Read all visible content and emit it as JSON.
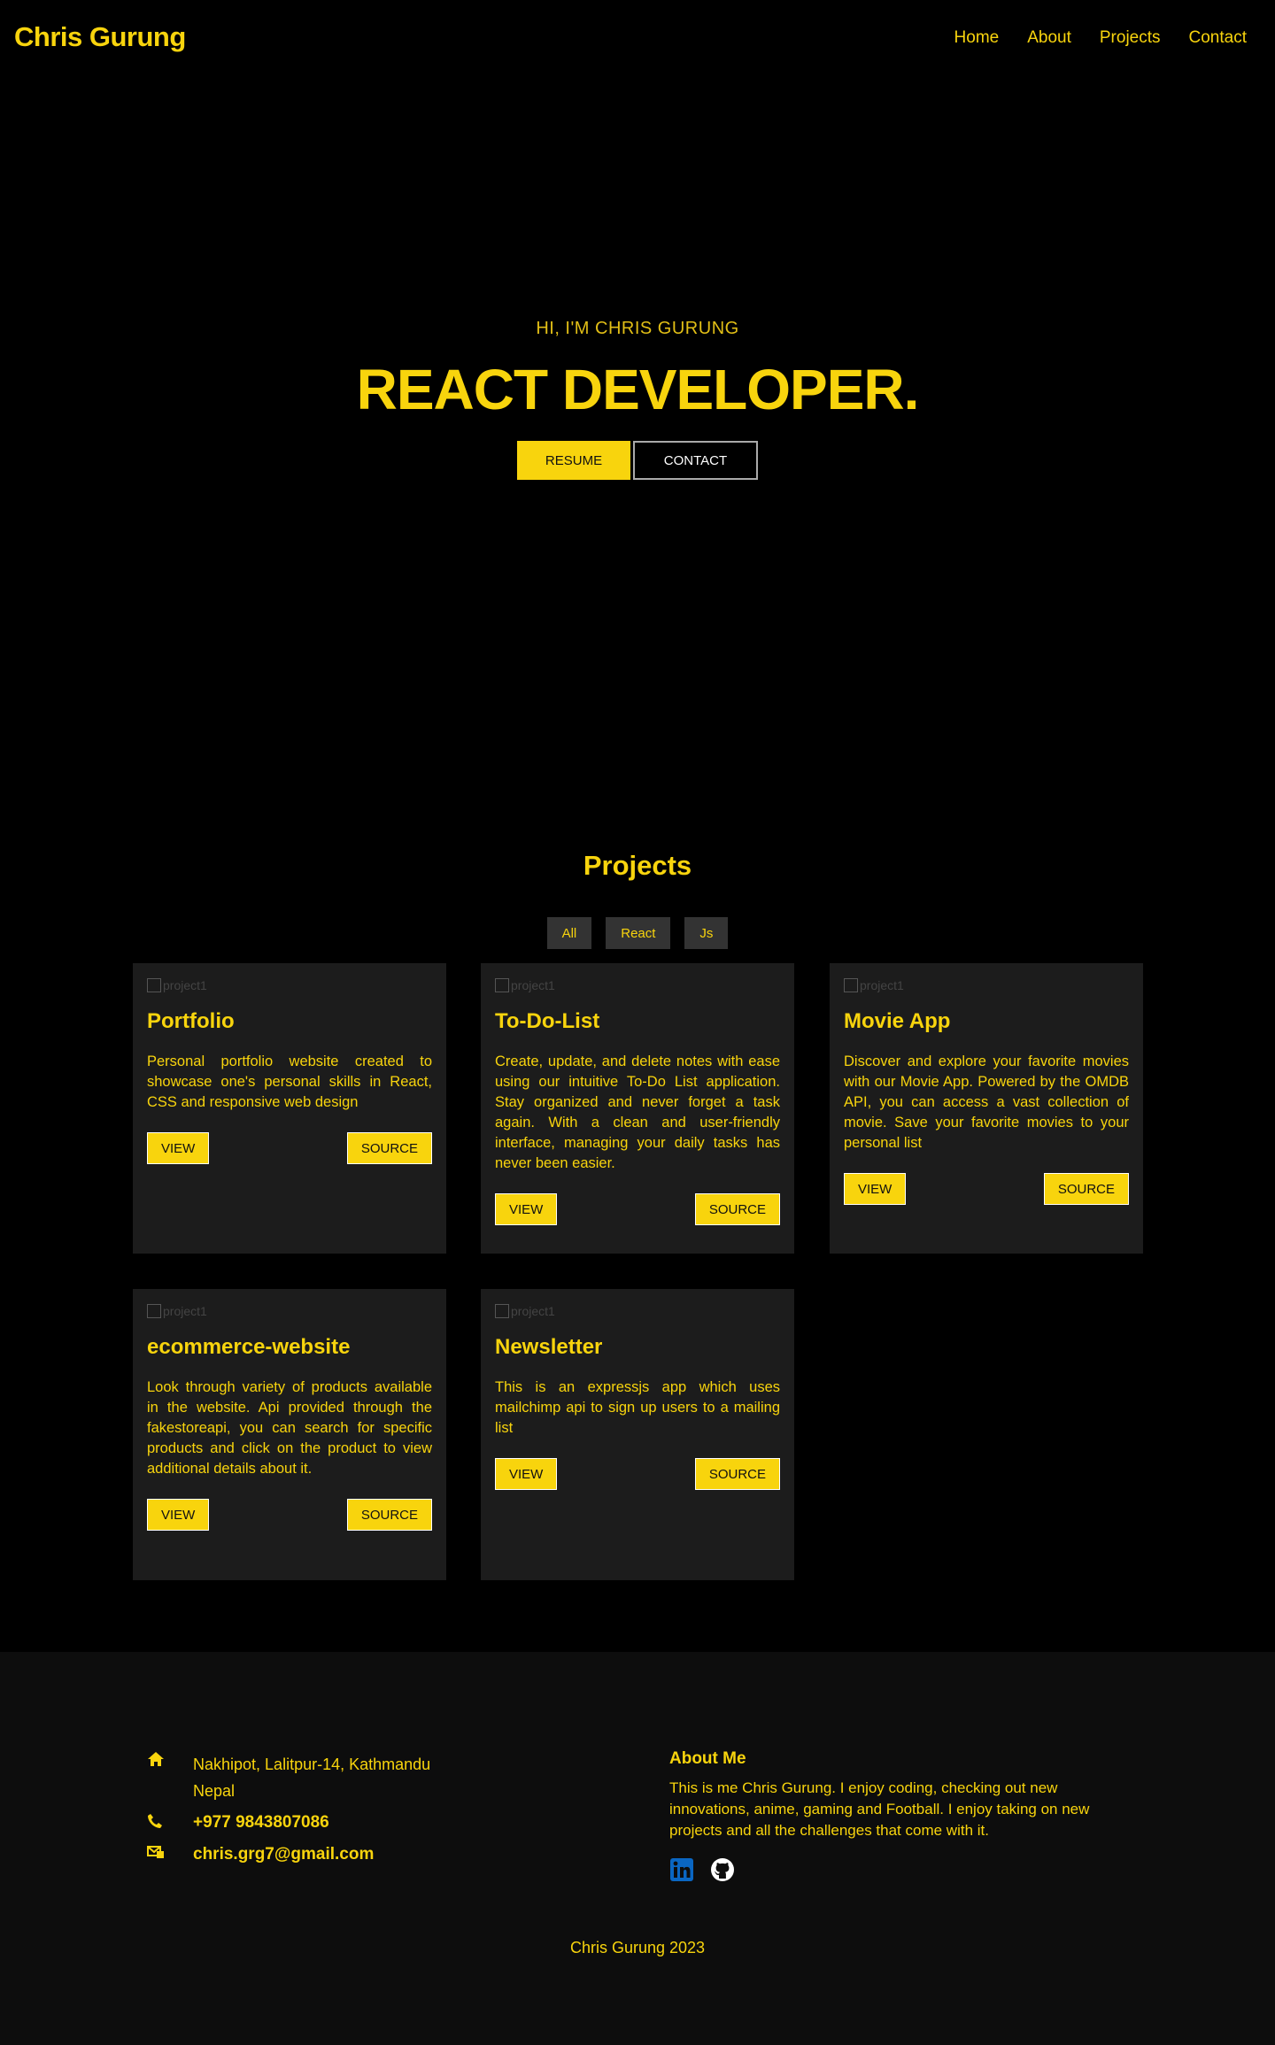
{
  "nav": {
    "brand": "Chris Gurung",
    "links": [
      "Home",
      "About",
      "Projects",
      "Contact"
    ]
  },
  "hero": {
    "kicker": "HI, I'M CHRIS GURUNG",
    "title": "REACT DEVELOPER.",
    "resume_label": "RESUME",
    "contact_label": "CONTACT"
  },
  "projects": {
    "title": "Projects",
    "filters": [
      "All",
      "React",
      "Js"
    ],
    "cards": [
      {
        "img_alt": "project1",
        "title": "Portfolio",
        "desc": "Personal portfolio website created to showcase one's personal skills in React, CSS and responsive web design",
        "view": "VIEW",
        "source": "SOURCE"
      },
      {
        "img_alt": "project1",
        "title": "To-Do-List",
        "desc": "Create, update, and delete notes with ease using our intuitive To-Do List application. Stay organized and never forget a task again. With a clean and user-friendly interface, managing your daily tasks has never been easier.",
        "view": "VIEW",
        "source": "SOURCE"
      },
      {
        "img_alt": "project1",
        "title": "Movie App",
        "desc": "Discover and explore your favorite movies with our Movie App. Powered by the OMDB API, you can access a vast collection of movie. Save your favorite movies to your personal list",
        "view": "VIEW",
        "source": "SOURCE"
      },
      {
        "img_alt": "project1",
        "title": "ecommerce-website",
        "desc": "Look through variety of products available in the website. Api provided through the fakestoreapi, you can search for specific products and click on the product to view additional details about it.",
        "view": "VIEW",
        "source": "SOURCE"
      },
      {
        "img_alt": "project1",
        "title": "Newsletter",
        "desc": "This is an expressjs app which uses mailchimp api to sign up users to a mailing list",
        "view": "VIEW",
        "source": "SOURCE"
      }
    ]
  },
  "footer": {
    "address_line1": "Nakhipot, Lalitpur-14, Kathmandu",
    "address_line2": "Nepal",
    "phone": "+977 9843807086",
    "email": "chris.grg7@gmail.com",
    "about_title": "About Me",
    "about_text": "This is me Chris Gurung. I enjoy coding, checking out new innovations, anime, gaming and Football. I enjoy taking on new projects and all the challenges that come with it.",
    "copyright": "Chris Gurung 2023",
    "icons": [
      "home-icon",
      "phone-icon",
      "mail-icon",
      "linkedin-icon",
      "github-icon"
    ]
  },
  "colors": {
    "accent": "#f8d40d",
    "background": "#000000",
    "card": "#1c1c1c",
    "footer": "#0d0d0d",
    "linkedin": "#0a66c2"
  }
}
